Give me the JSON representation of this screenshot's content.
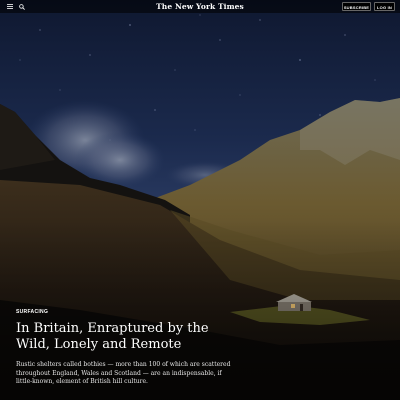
{
  "header": {
    "logo_text": "The New York Times",
    "subscribe_label": "SUBSCRIBE",
    "login_label": "LOG IN",
    "menu_icon": "hamburger-menu-icon",
    "search_icon": "search-icon"
  },
  "article": {
    "kicker": "SURFACING",
    "headline": "In Britain, Enraptured by the Wild, Lonely and Remote",
    "summary": "Rustic shelters called bothies — more than 100 of which are scattered throughout England, Wales and Scotland — are an indispensable, if little-known, element of British hill culture."
  },
  "colors": {
    "sky": "#1c2a4a",
    "mountain_sunlit": "#7a6a3a",
    "text": "#ffffff"
  }
}
